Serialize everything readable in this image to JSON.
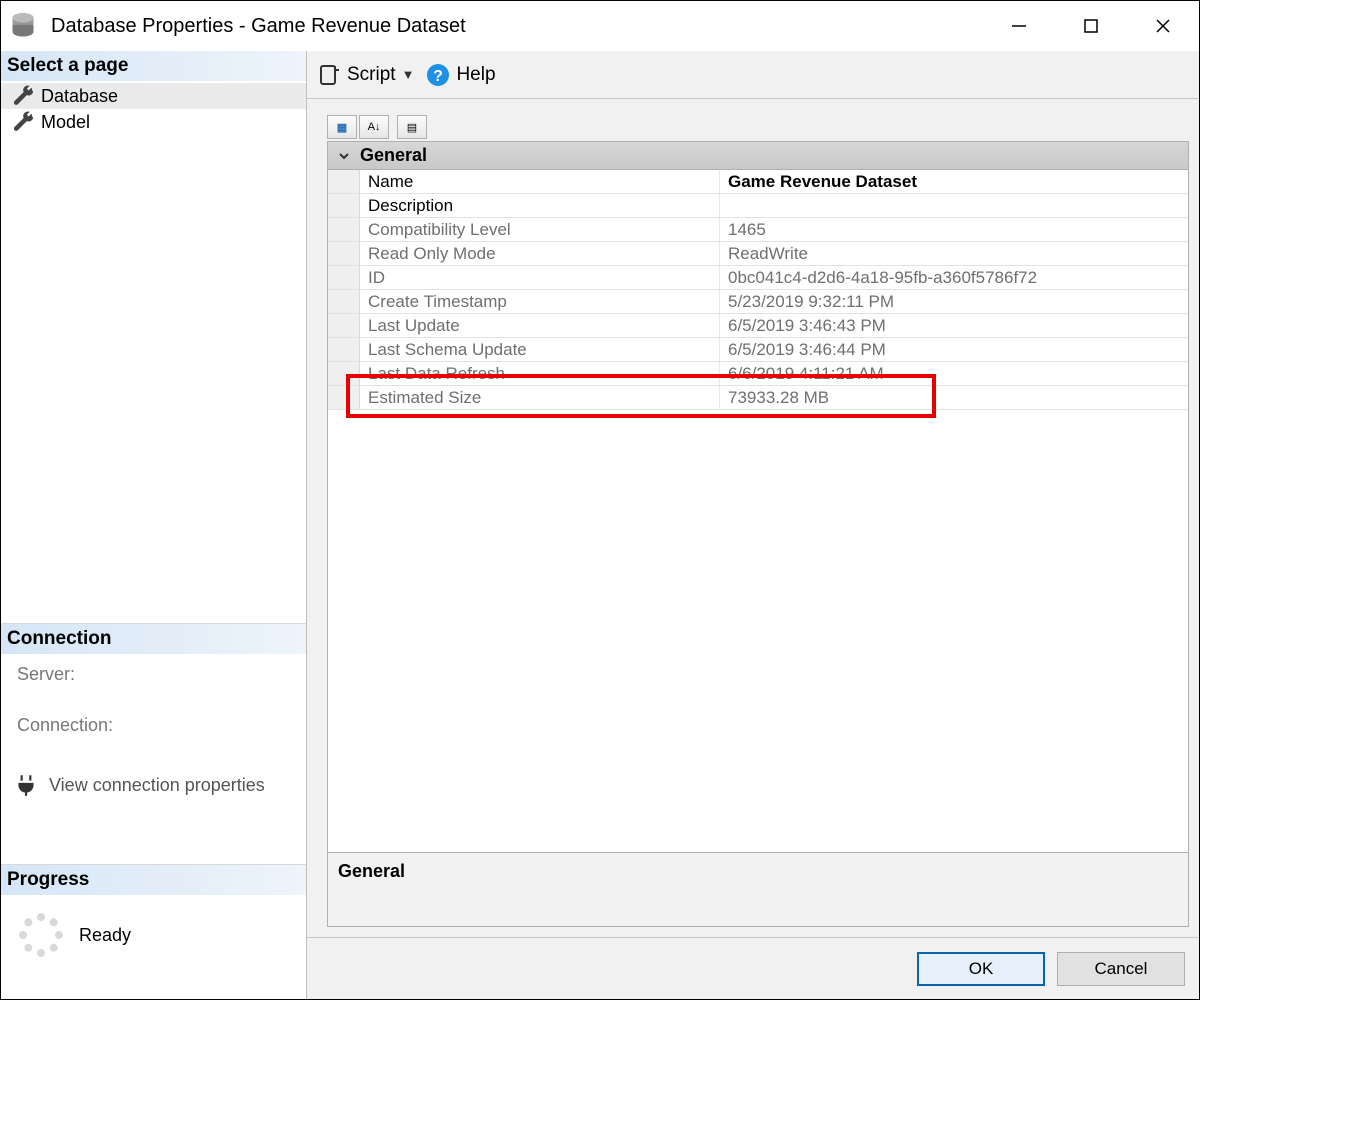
{
  "titlebar": {
    "title": "Database Properties - Game Revenue Dataset"
  },
  "sidebar": {
    "select_page_label": "Select a page",
    "pages": [
      {
        "label": "Database",
        "selected": true
      },
      {
        "label": "Model",
        "selected": false
      }
    ],
    "connection_label": "Connection",
    "server_label": "Server:",
    "connection_field_label": "Connection:",
    "view_connection_label": "View connection properties",
    "progress_label": "Progress",
    "progress_status": "Ready"
  },
  "toolbar": {
    "script_label": "Script",
    "help_label": "Help"
  },
  "property_grid": {
    "group_label": "General",
    "rows": [
      {
        "label": "Name",
        "value": "Game Revenue Dataset",
        "readonly": false,
        "bold": true
      },
      {
        "label": "Description",
        "value": "",
        "readonly": false,
        "bold": false
      },
      {
        "label": "Compatibility Level",
        "value": "1465",
        "readonly": true,
        "bold": false
      },
      {
        "label": "Read Only Mode",
        "value": "ReadWrite",
        "readonly": true,
        "bold": false
      },
      {
        "label": "ID",
        "value": "0bc041c4-d2d6-4a18-95fb-a360f5786f72",
        "readonly": true,
        "bold": false
      },
      {
        "label": "Create Timestamp",
        "value": "5/23/2019 9:32:11 PM",
        "readonly": true,
        "bold": false
      },
      {
        "label": "Last Update",
        "value": "6/5/2019 3:46:43 PM",
        "readonly": true,
        "bold": false
      },
      {
        "label": "Last Schema Update",
        "value": "6/5/2019 3:46:44 PM",
        "readonly": true,
        "bold": false
      },
      {
        "label": "Last Data Refresh",
        "value": "6/6/2019 4:11:21 AM",
        "readonly": true,
        "bold": false
      },
      {
        "label": "Estimated Size",
        "value": "73933.28 MB",
        "readonly": true,
        "bold": false,
        "highlight": true
      }
    ],
    "description_title": "General"
  },
  "footer": {
    "ok": "OK",
    "cancel": "Cancel"
  }
}
